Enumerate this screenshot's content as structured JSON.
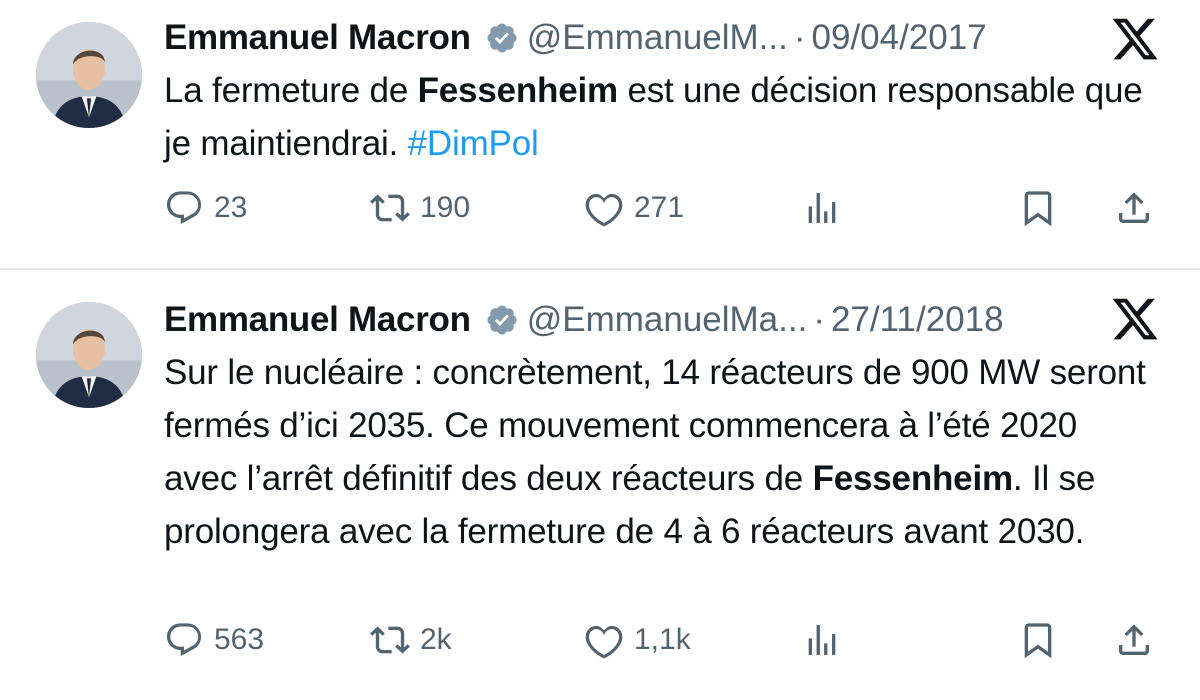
{
  "tweets": [
    {
      "author": "Emmanuel Macron",
      "handle": "@EmmanuelM...",
      "date": "09/04/2017",
      "text_parts": {
        "p1": "La fermeture de ",
        "bold1": "Fessenheim",
        "p2": " est une décision responsable que je maintiendrai. ",
        "hashtag": "#DimPol"
      },
      "replies": "23",
      "retweets": "190",
      "likes": "271"
    },
    {
      "author": "Emmanuel Macron",
      "handle": "@EmmanuelMa...",
      "date": "27/11/2018",
      "text_parts": {
        "p1": "Sur le nucléaire : concrètement, 14 réacteurs de 900 MW seront fermés d’ici 2035. Ce mouvement commencera à l’été 2020 avec l’arrêt définitif des deux réacteurs de ",
        "bold1": "Fessenheim",
        "p2": ". Il se prolongera avec la fermeture de 4 à 6 réacteurs avant 2030."
      },
      "replies": "563",
      "retweets": "2k",
      "likes": "1,1k"
    }
  ],
  "separator": "·",
  "icons": {
    "verified": "verified-badge-icon",
    "platform": "x-logo-icon",
    "reply": "reply-icon",
    "retweet": "retweet-icon",
    "like": "like-icon",
    "views": "views-icon",
    "bookmark": "bookmark-icon",
    "share": "share-icon"
  },
  "colors": {
    "text": "#0f1419",
    "secondary": "#536471",
    "hashtag": "#1d9bf0",
    "divider": "#e6e9ec"
  }
}
